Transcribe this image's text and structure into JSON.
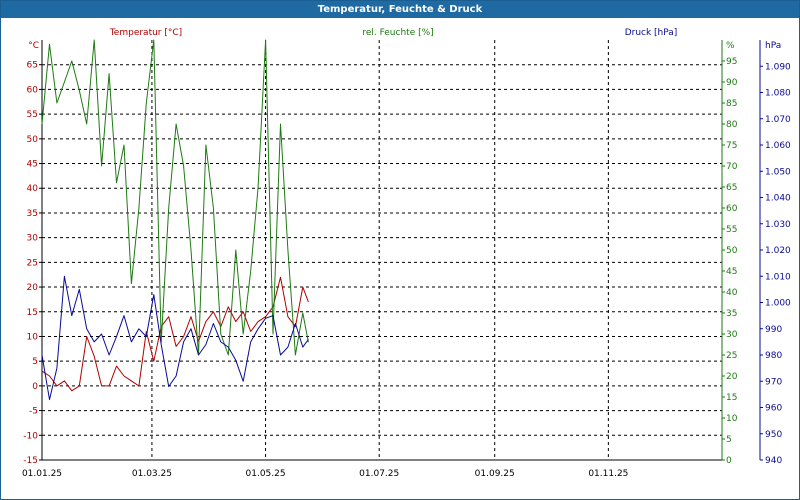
{
  "window": {
    "title": "Temperatur, Feuchte & Druck"
  },
  "colors": {
    "temperature": "#b00000",
    "humidity": "#1e7a12",
    "pressure": "#0a0a96",
    "titlebar": "#1f6aa3"
  },
  "chart_data": {
    "type": "line",
    "title": "Temperatur, Feuchte & Druck",
    "grid": true,
    "x_ticks": [
      "01.01.25",
      "01.03.25",
      "01.05.25",
      "01.07.25",
      "01.09.25",
      "01.11.25"
    ],
    "x_range": [
      "2025-01-01",
      "2025-12-31"
    ],
    "axes": {
      "temperature": {
        "label": "Temperatur [°C]",
        "unit": "°C",
        "range": [
          -15,
          70
        ],
        "ticks": [
          "-15",
          "-10",
          "-5",
          "0",
          "5",
          "10",
          "15",
          "20",
          "25",
          "30",
          "35",
          "40",
          "45",
          "50",
          "55",
          "60",
          "65"
        ]
      },
      "humidity": {
        "label": "rel. Feuchte [%]",
        "unit": "%",
        "range": [
          0,
          100
        ],
        "ticks": [
          "0",
          "5",
          "10",
          "15",
          "20",
          "25",
          "30",
          "35",
          "40",
          "45",
          "50",
          "55",
          "60",
          "65",
          "70",
          "75",
          "80",
          "85",
          "90",
          "95"
        ]
      },
      "pressure": {
        "label": "Druck [hPa]",
        "unit": "hPa",
        "range": [
          940,
          1100
        ],
        "ticks": [
          "940",
          "950",
          "960",
          "970",
          "980",
          "990",
          "1.000",
          "1.010",
          "1.020",
          "1.030",
          "1.040",
          "1.050",
          "1.060",
          "1.070",
          "1.080",
          "1.090"
        ]
      }
    },
    "series": [
      {
        "name": "Temperatur [°C]",
        "axis": "temperature",
        "x": [
          "2025-01-01",
          "2025-01-05",
          "2025-01-09",
          "2025-01-13",
          "2025-01-17",
          "2025-01-21",
          "2025-01-25",
          "2025-01-29",
          "2025-02-02",
          "2025-02-06",
          "2025-02-10",
          "2025-02-14",
          "2025-02-18",
          "2025-02-22",
          "2025-02-26",
          "2025-03-02",
          "2025-03-06",
          "2025-03-10",
          "2025-03-14",
          "2025-03-18",
          "2025-03-22",
          "2025-03-26",
          "2025-03-30",
          "2025-04-03",
          "2025-04-07",
          "2025-04-11",
          "2025-04-15",
          "2025-04-19",
          "2025-04-23",
          "2025-04-27",
          "2025-05-01",
          "2025-05-05",
          "2025-05-09",
          "2025-05-13",
          "2025-05-17",
          "2025-05-21",
          "2025-05-24"
        ],
        "y": [
          3,
          2,
          0,
          1,
          -1,
          0,
          10,
          6,
          0,
          0,
          4,
          2,
          1,
          0,
          11,
          5,
          12,
          14,
          8,
          10,
          14,
          9,
          13,
          15,
          12,
          16,
          13,
          15,
          11,
          13,
          14,
          16,
          22,
          14,
          12,
          20,
          17
        ]
      },
      {
        "name": "rel. Feuchte [%]",
        "axis": "humidity",
        "x": [
          "2025-01-01",
          "2025-01-05",
          "2025-01-09",
          "2025-01-13",
          "2025-01-17",
          "2025-01-21",
          "2025-01-25",
          "2025-01-29",
          "2025-02-02",
          "2025-02-06",
          "2025-02-10",
          "2025-02-14",
          "2025-02-18",
          "2025-02-22",
          "2025-02-26",
          "2025-03-02",
          "2025-03-06",
          "2025-03-10",
          "2025-03-14",
          "2025-03-18",
          "2025-03-22",
          "2025-03-26",
          "2025-03-30",
          "2025-04-03",
          "2025-04-07",
          "2025-04-11",
          "2025-04-15",
          "2025-04-19",
          "2025-04-23",
          "2025-04-27",
          "2025-05-01",
          "2025-05-05",
          "2025-05-09",
          "2025-05-13",
          "2025-05-17",
          "2025-05-21",
          "2025-05-24"
        ],
        "y": [
          80,
          99,
          85,
          90,
          95,
          88,
          80,
          100,
          70,
          92,
          66,
          75,
          42,
          60,
          85,
          100,
          28,
          60,
          80,
          70,
          50,
          25,
          75,
          60,
          30,
          25,
          50,
          30,
          45,
          65,
          100,
          30,
          80,
          50,
          25,
          35,
          28
        ]
      },
      {
        "name": "Druck [hPa]",
        "axis": "pressure",
        "x": [
          "2025-01-01",
          "2025-01-05",
          "2025-01-09",
          "2025-01-13",
          "2025-01-17",
          "2025-01-21",
          "2025-01-25",
          "2025-01-29",
          "2025-02-02",
          "2025-02-06",
          "2025-02-10",
          "2025-02-14",
          "2025-02-18",
          "2025-02-22",
          "2025-02-26",
          "2025-03-02",
          "2025-03-06",
          "2025-03-10",
          "2025-03-14",
          "2025-03-18",
          "2025-03-22",
          "2025-03-26",
          "2025-03-30",
          "2025-04-03",
          "2025-04-07",
          "2025-04-11",
          "2025-04-15",
          "2025-04-19",
          "2025-04-23",
          "2025-04-27",
          "2025-05-01",
          "2025-05-05",
          "2025-05-09",
          "2025-05-13",
          "2025-05-17",
          "2025-05-21",
          "2025-05-24"
        ],
        "y": [
          980,
          963,
          975,
          1010,
          995,
          1005,
          990,
          985,
          988,
          980,
          987,
          995,
          985,
          990,
          987,
          1003,
          984,
          968,
          972,
          985,
          990,
          980,
          984,
          992,
          985,
          983,
          978,
          970,
          985,
          990,
          994,
          995,
          980,
          983,
          992,
          983,
          986
        ]
      }
    ]
  }
}
